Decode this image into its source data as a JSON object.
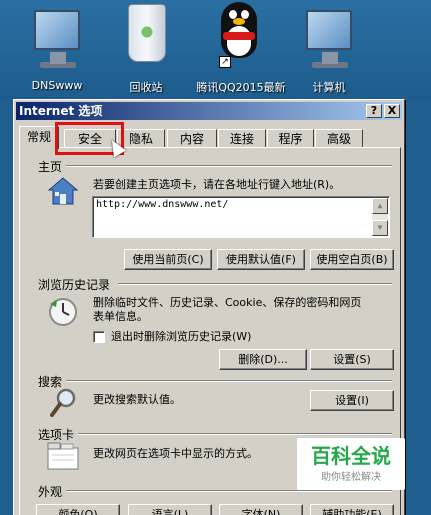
{
  "desktop": {
    "icons": [
      {
        "label": "DNSwww",
        "icon": "computer-icon"
      },
      {
        "label": "回收站",
        "icon": "recycle-bin-icon"
      },
      {
        "label": "腾讯QQ2015最新",
        "icon": "qq-penguin-icon"
      },
      {
        "label": "计算机",
        "icon": "computer-icon"
      }
    ]
  },
  "window": {
    "title": "Internet 选项",
    "title_buttons": [
      "?",
      "X"
    ]
  },
  "tabs": [
    {
      "label": "常规",
      "active": true
    },
    {
      "label": "安全",
      "active": false
    },
    {
      "label": "隐私",
      "active": false
    },
    {
      "label": "内容",
      "active": false
    },
    {
      "label": "连接",
      "active": false
    },
    {
      "label": "程序",
      "active": false
    },
    {
      "label": "高级",
      "active": false
    }
  ],
  "homepage": {
    "section_title": "主页",
    "instruction": "若要创建主页选项卡，请在各地址行键入地址(R)。",
    "address_value": "http://www.dnswww.net/",
    "buttons": [
      "使用当前页(C)",
      "使用默认值(F)",
      "使用空白页(B)"
    ]
  },
  "history": {
    "section_title": "浏览历史记录",
    "description_line1": "删除临时文件、历史记录、Cookie、保存的密码和网页",
    "description_line2": "表单信息。",
    "checkbox_label": "退出时删除浏览历史记录(W)",
    "checkbox_checked": false,
    "buttons": [
      "删除(D)...",
      "设置(S)"
    ]
  },
  "search": {
    "section_title": "搜索",
    "description": "更改搜索默认值。",
    "button": "设置(I)"
  },
  "tabs_section": {
    "section_title": "选项卡",
    "description": "更改网页在选项卡中显示的方式。"
  },
  "appearance": {
    "section_title": "外观",
    "buttons": [
      "颜色(O)",
      "语言(L)",
      "字体(N)",
      "辅助功能(E)"
    ]
  },
  "watermark": {
    "main": "百科全说",
    "sub": "助你轻松解决"
  },
  "colors": {
    "highlight": "#e01010",
    "title_bar": "#0a246a",
    "dialog_bg": "#d4d0c8"
  }
}
